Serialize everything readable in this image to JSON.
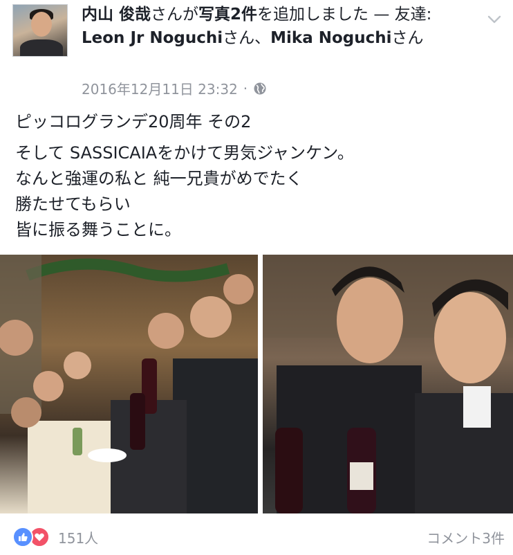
{
  "post": {
    "author": "内山 俊哉",
    "action_text": "さんが",
    "photos_label": "写真2件",
    "action_suffix": "を追加しました — 友達: ",
    "tagged_1": "Leon Jr Noguchi",
    "separator": "さん、",
    "tagged_2": "Mika Noguchi",
    "suffix": "さん",
    "timestamp": "2016年12月11日 23:32",
    "dot": "·",
    "privacy_icon": "globe-icon",
    "title_line": "ピッコログランデ20周年 その2",
    "body_lines": [
      "そして SASSICAIAをかけて男気ジャンケン。",
      "なんと強運の私と 純一兄貴がめでたく",
      "勝たせてもらい",
      "皆に振る舞うことに。"
    ]
  },
  "footer": {
    "reactions_count": "151人",
    "comments_label": "コメント3件"
  },
  "colors": {
    "like_blue": "#5890ff",
    "love_red": "#f25268",
    "meta_gray": "#90949c"
  }
}
